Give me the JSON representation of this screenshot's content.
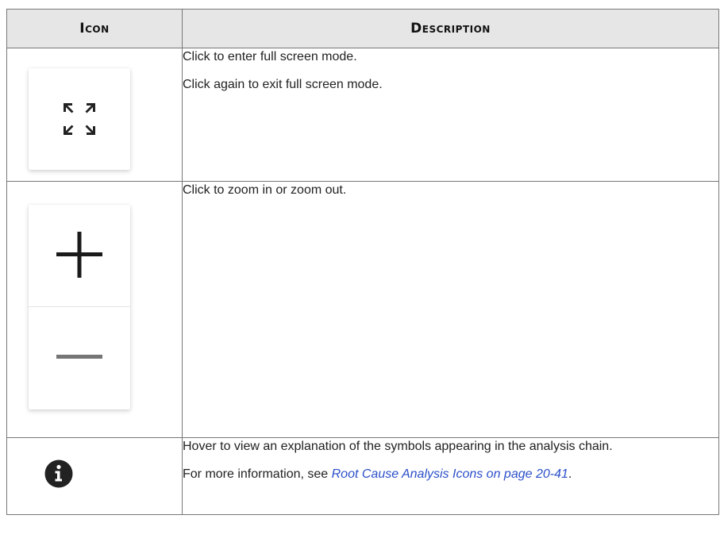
{
  "table": {
    "headers": {
      "icon": "Icon",
      "description": "Description"
    },
    "rows": [
      {
        "icon": "fullscreen-expand-icon",
        "lines": [
          "Click to enter full screen mode.",
          "Click again to exit full screen mode."
        ]
      },
      {
        "icon": "zoom-in-out-icon",
        "lines": [
          "Click to zoom in or zoom out."
        ]
      },
      {
        "icon": "info-icon",
        "lines": [
          "Hover to view an explanation of the symbols appearing in the analysis chain."
        ],
        "more_info": {
          "prefix": "For more information, see ",
          "link_text": "Root Cause Analysis Icons on page 20-41",
          "suffix": "."
        }
      }
    ]
  },
  "colors": {
    "header_bg": "#e6e6e6",
    "border": "#777777",
    "link": "#2b4fc9",
    "icon_dark": "#222222",
    "zoom_out_grey": "#757575"
  }
}
